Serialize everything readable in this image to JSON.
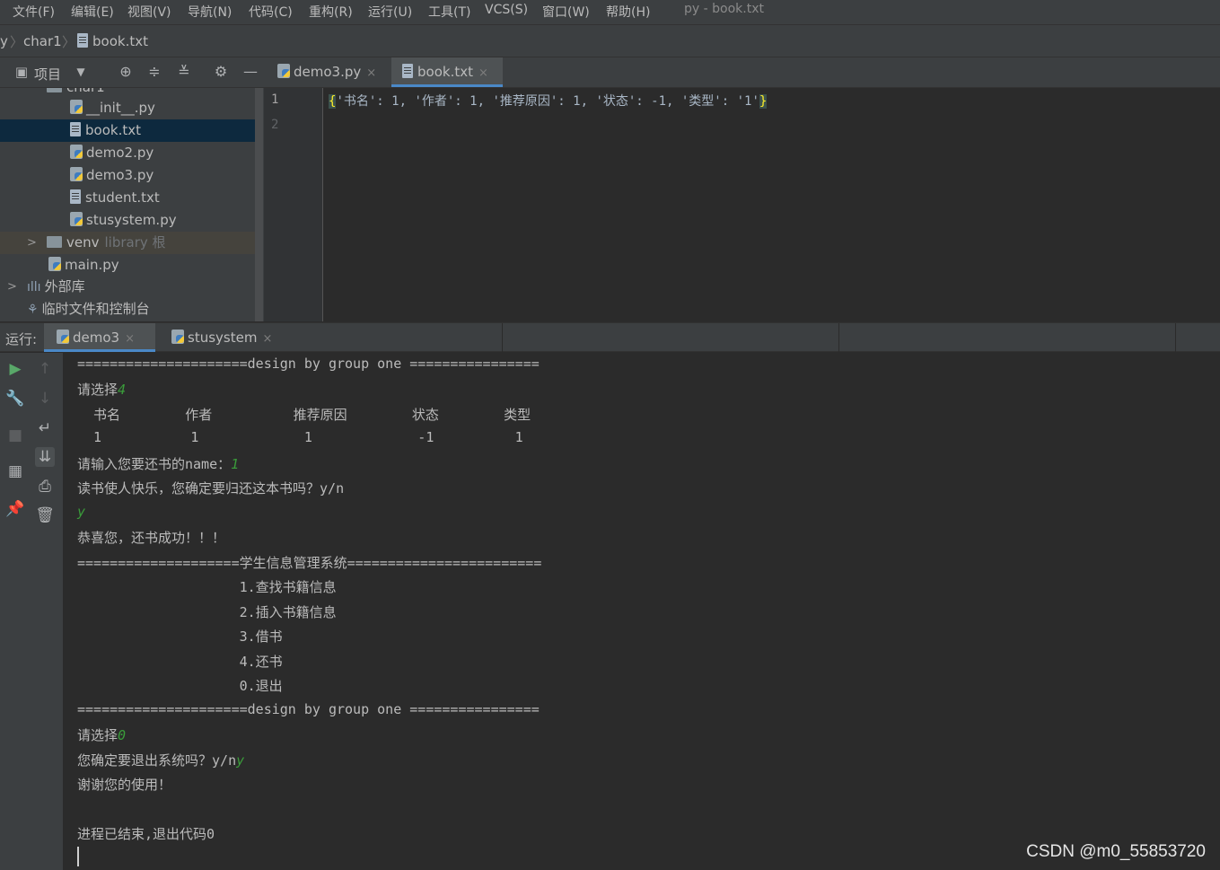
{
  "menu": {
    "items": [
      "文件(F)",
      "编辑(E)",
      "视图(V)",
      "导航(N)",
      "代码(C)",
      "重构(R)",
      "运行(U)",
      "工具(T)",
      "VCS(S)",
      "窗口(W)",
      "帮助(H)"
    ],
    "title": "py - book.txt"
  },
  "breadcrumb": {
    "lead": "y",
    "folder": "char1",
    "file": "book.txt"
  },
  "toolbar": {
    "project_label": "项目"
  },
  "editor_tabs": [
    {
      "label": "demo3.py",
      "close": "×"
    },
    {
      "label": "book.txt",
      "close": "×"
    }
  ],
  "project_tree": {
    "partial_folder": "char1",
    "items": [
      "__init__.py",
      "book.txt",
      "demo2.py",
      "demo3.py",
      "student.txt",
      "stusystem.py"
    ],
    "venv": {
      "label": "venv",
      "hint": "library 根"
    },
    "main": "main.py",
    "external": "外部库",
    "scratches": "临时文件和控制台"
  },
  "editor": {
    "line_numbers": [
      "1",
      "2"
    ],
    "line1_open": "{",
    "line1_body": "'书名': 1, '作者': 1, '推荐原因': 1, '状态': -1, '类型': '1'",
    "line1_close": "}"
  },
  "run": {
    "label": "运行:",
    "tabs": [
      {
        "label": "demo3",
        "close": "×"
      },
      {
        "label": "stusystem",
        "close": "×"
      }
    ]
  },
  "console": {
    "l1": "=====================design by group one ================",
    "l2_prompt": "请选择",
    "l2_input": "4",
    "l3": "  书名        作者          推荐原因        状态        类型",
    "l4": "  1           1             1             -1          1",
    "l5_prompt": "请输入您要还书的name：",
    "l5_input": "1",
    "l6": "读书使人快乐，您确定要归还这本书吗？y/n",
    "l7_input": "y",
    "l8": "恭喜您，还书成功！！！",
    "l9": "====================学生信息管理系统========================",
    "l10": "                    1.查找书籍信息",
    "l11": "                    2.插入书籍信息",
    "l12": "                    3.借书",
    "l13": "                    4.还书",
    "l14": "                    0.退出",
    "l15": "=====================design by group one ================",
    "l16_prompt": "请选择",
    "l16_input": "0",
    "l17_prompt": "您确定要退出系统吗？y/n",
    "l17_input": "y",
    "l18": "谢谢您的使用！",
    "l19": "进程已结束,退出代码0"
  },
  "watermark": "CSDN @m0_55853720"
}
